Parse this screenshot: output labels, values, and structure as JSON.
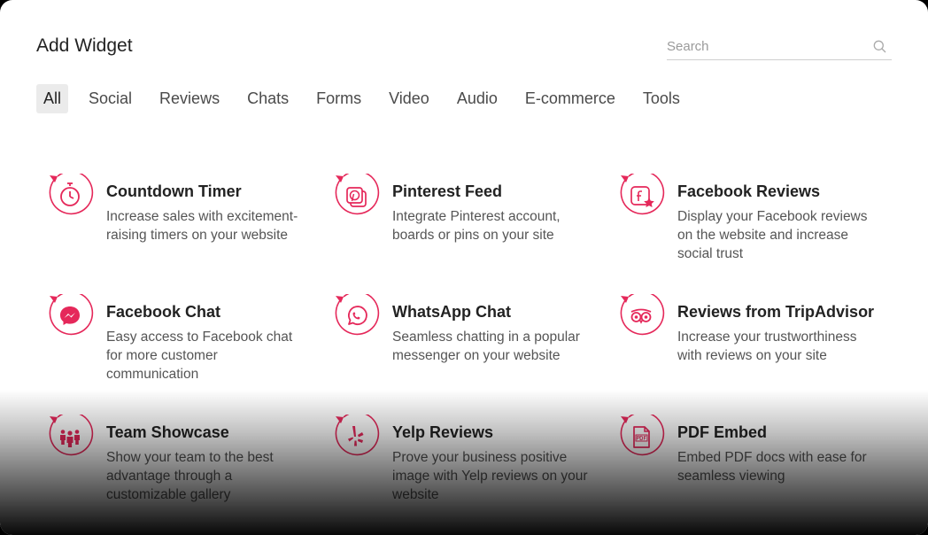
{
  "header": {
    "title": "Add Widget"
  },
  "search": {
    "placeholder": "Search",
    "value": ""
  },
  "tabs": [
    {
      "label": "All",
      "active": true
    },
    {
      "label": "Social"
    },
    {
      "label": "Reviews"
    },
    {
      "label": "Chats"
    },
    {
      "label": "Forms"
    },
    {
      "label": "Video"
    },
    {
      "label": "Audio"
    },
    {
      "label": "E-commerce"
    },
    {
      "label": "Tools"
    }
  ],
  "colors": {
    "accent": "#e5285a"
  },
  "widgets": [
    {
      "title": "Countdown Timer",
      "desc": "Increase sales with excitement-raising timers on your website",
      "icon": "stopwatch-icon"
    },
    {
      "title": "Pinterest Feed",
      "desc": "Integrate Pinterest account, boards or pins on your site",
      "icon": "pinterest-icon"
    },
    {
      "title": "Facebook Reviews",
      "desc": "Display your Facebook reviews on the website and increase social trust",
      "icon": "facebook-review-icon"
    },
    {
      "title": "Facebook Chat",
      "desc": "Easy access to Facebook chat for more customer communication",
      "icon": "messenger-icon"
    },
    {
      "title": "WhatsApp Chat",
      "desc": "Seamless chatting in a popular messenger on your website",
      "icon": "whatsapp-icon"
    },
    {
      "title": "Reviews from TripAdvisor",
      "desc": "Increase your trustworthiness with reviews on your site",
      "icon": "tripadvisor-icon"
    },
    {
      "title": "Team Showcase",
      "desc": "Show your team to the best advantage through a customizable gallery",
      "icon": "team-icon"
    },
    {
      "title": "Yelp Reviews",
      "desc": "Prove your business positive image with Yelp reviews on your website",
      "icon": "yelp-icon"
    },
    {
      "title": "PDF Embed",
      "desc": "Embed PDF docs with ease for seamless viewing",
      "icon": "pdf-icon"
    }
  ]
}
